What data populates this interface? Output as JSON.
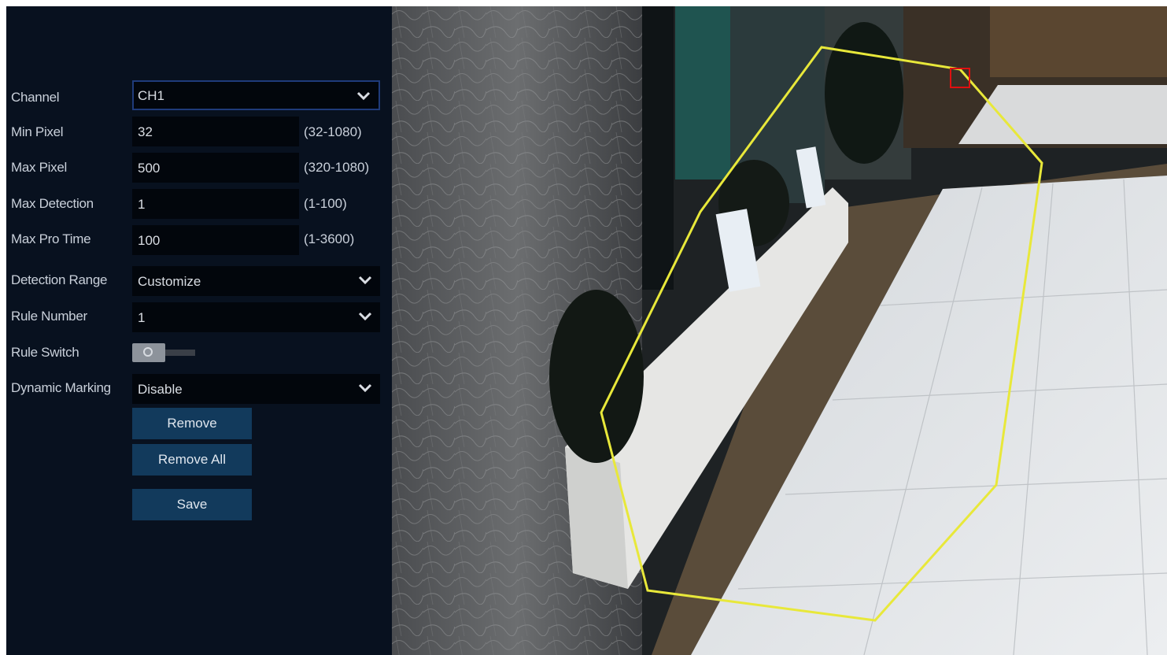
{
  "form": {
    "channel": {
      "label": "Channel",
      "value": "CH1"
    },
    "min_pixel": {
      "label": "Min Pixel",
      "value": "32",
      "range": "(32-1080)"
    },
    "max_pixel": {
      "label": "Max Pixel",
      "value": "500",
      "range": "(320-1080)"
    },
    "max_detection": {
      "label": "Max Detection",
      "value": "1",
      "range": "(1-100)"
    },
    "max_pro_time": {
      "label": "Max Pro Time",
      "value": "100",
      "range": "(1-3600)"
    },
    "detection_range": {
      "label": "Detection Range",
      "value": "Customize"
    },
    "rule_number": {
      "label": "Rule Number",
      "value": "1"
    },
    "rule_switch": {
      "label": "Rule Switch",
      "enabled": false
    },
    "dynamic_marking": {
      "label": "Dynamic Marking",
      "value": "Disable"
    }
  },
  "buttons": {
    "remove": "Remove",
    "remove_all": "Remove All",
    "save": "Save"
  },
  "colors": {
    "panel_bg": "#08111f",
    "field_bg": "#02060c",
    "button_bg": "#123a5c",
    "region_outline": "#e8e83a",
    "handle": "#e01010"
  },
  "icons": {
    "dropdown": "chevron-down-icon",
    "handle": "region-vertex-handle"
  }
}
